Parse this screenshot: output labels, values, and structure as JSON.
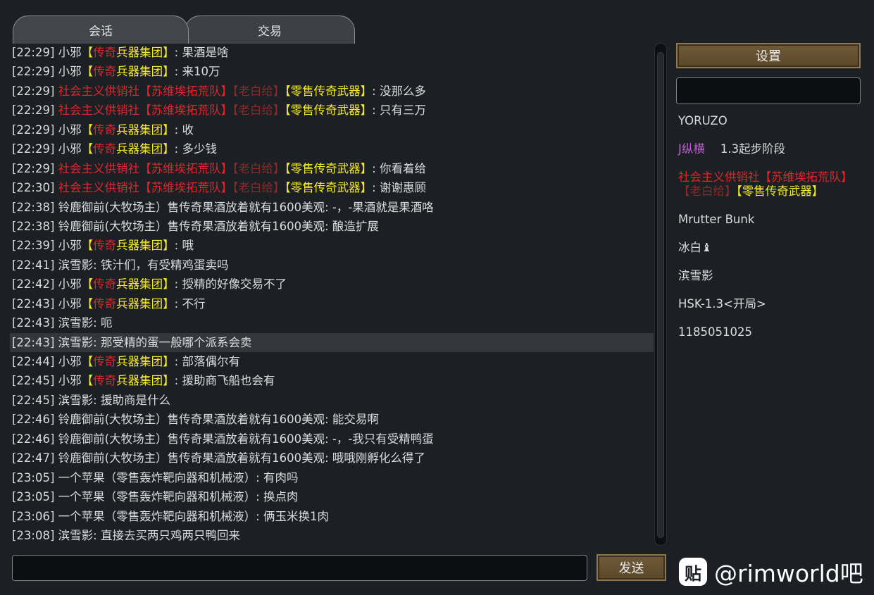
{
  "tabs": [
    {
      "label": "会话",
      "active": true
    },
    {
      "label": "交易",
      "active": false
    }
  ],
  "colors": {
    "white": "#dcdcdc",
    "red": "#e0262b",
    "yellow": "#f5ea2a",
    "darkred": "#8a2a2a",
    "purple": "#c45bd6"
  },
  "messages": [
    {
      "segments": [
        {
          "text": "[22:29] 小邪",
          "color": "#dcdcdc"
        },
        {
          "text": "【",
          "color": "#f5ea2a"
        },
        {
          "text": "传奇",
          "color": "#e0262b"
        },
        {
          "text": "兵器集团】",
          "color": "#f5ea2a"
        },
        {
          "text": ": 果酒是啥",
          "color": "#dcdcdc"
        }
      ]
    },
    {
      "segments": [
        {
          "text": "[22:29] 小邪",
          "color": "#dcdcdc"
        },
        {
          "text": "【",
          "color": "#f5ea2a"
        },
        {
          "text": "传奇",
          "color": "#e0262b"
        },
        {
          "text": "兵器集团】",
          "color": "#f5ea2a"
        },
        {
          "text": ": 来10万",
          "color": "#dcdcdc"
        }
      ]
    },
    {
      "segments": [
        {
          "text": "[22:29] ",
          "color": "#dcdcdc"
        },
        {
          "text": "社会主义供销社【苏维埃拓荒队】",
          "color": "#e0262b"
        },
        {
          "text": "【老白给】",
          "color": "#8a2a2a"
        },
        {
          "text": "【零售传奇武器】",
          "color": "#f5ea2a"
        },
        {
          "text": ": 没那么多",
          "color": "#dcdcdc"
        }
      ]
    },
    {
      "segments": [
        {
          "text": "[22:29] ",
          "color": "#dcdcdc"
        },
        {
          "text": "社会主义供销社【苏维埃拓荒队】",
          "color": "#e0262b"
        },
        {
          "text": "【老白给】",
          "color": "#8a2a2a"
        },
        {
          "text": "【零售传奇武器】",
          "color": "#f5ea2a"
        },
        {
          "text": ": 只有三万",
          "color": "#dcdcdc"
        }
      ]
    },
    {
      "segments": [
        {
          "text": "[22:29] 小邪",
          "color": "#dcdcdc"
        },
        {
          "text": "【",
          "color": "#f5ea2a"
        },
        {
          "text": "传奇",
          "color": "#e0262b"
        },
        {
          "text": "兵器集团】",
          "color": "#f5ea2a"
        },
        {
          "text": ": 收",
          "color": "#dcdcdc"
        }
      ]
    },
    {
      "segments": [
        {
          "text": "[22:29] 小邪",
          "color": "#dcdcdc"
        },
        {
          "text": "【",
          "color": "#f5ea2a"
        },
        {
          "text": "传奇",
          "color": "#e0262b"
        },
        {
          "text": "兵器集团】",
          "color": "#f5ea2a"
        },
        {
          "text": ": 多少钱",
          "color": "#dcdcdc"
        }
      ]
    },
    {
      "segments": [
        {
          "text": "[22:29] ",
          "color": "#dcdcdc"
        },
        {
          "text": "社会主义供销社【苏维埃拓荒队】",
          "color": "#e0262b"
        },
        {
          "text": "【老白给】",
          "color": "#8a2a2a"
        },
        {
          "text": "【零售传奇武器】",
          "color": "#f5ea2a"
        },
        {
          "text": ": 你看着给",
          "color": "#dcdcdc"
        }
      ]
    },
    {
      "segments": [
        {
          "text": "[22:30] ",
          "color": "#dcdcdc"
        },
        {
          "text": "社会主义供销社【苏维埃拓荒队】",
          "color": "#e0262b"
        },
        {
          "text": "【老白给】",
          "color": "#8a2a2a"
        },
        {
          "text": "【零售传奇武器】",
          "color": "#f5ea2a"
        },
        {
          "text": ": 谢谢惠顾",
          "color": "#dcdcdc"
        }
      ]
    },
    {
      "segments": [
        {
          "text": "[22:38] 铃鹿御前(大牧场主）售传奇果酒放着就有1600美观: -，-果酒就是果酒咯",
          "color": "#dcdcdc"
        }
      ]
    },
    {
      "segments": [
        {
          "text": "[22:38] 铃鹿御前(大牧场主）售传奇果酒放着就有1600美观: 酿造扩展",
          "color": "#dcdcdc"
        }
      ]
    },
    {
      "segments": [
        {
          "text": "[22:39] 小邪",
          "color": "#dcdcdc"
        },
        {
          "text": "【",
          "color": "#f5ea2a"
        },
        {
          "text": "传奇",
          "color": "#e0262b"
        },
        {
          "text": "兵器集团】",
          "color": "#f5ea2a"
        },
        {
          "text": ": 哦",
          "color": "#dcdcdc"
        }
      ]
    },
    {
      "segments": [
        {
          "text": "[22:41] 滨雪影: 铁汁们，有受精鸡蛋卖吗",
          "color": "#dcdcdc"
        }
      ]
    },
    {
      "segments": [
        {
          "text": "[22:42] 小邪",
          "color": "#dcdcdc"
        },
        {
          "text": "【",
          "color": "#f5ea2a"
        },
        {
          "text": "传奇",
          "color": "#e0262b"
        },
        {
          "text": "兵器集团】",
          "color": "#f5ea2a"
        },
        {
          "text": ": 授精的好像交易不了",
          "color": "#dcdcdc"
        }
      ]
    },
    {
      "segments": [
        {
          "text": "[22:43] 小邪",
          "color": "#dcdcdc"
        },
        {
          "text": "【",
          "color": "#f5ea2a"
        },
        {
          "text": "传奇",
          "color": "#e0262b"
        },
        {
          "text": "兵器集团】",
          "color": "#f5ea2a"
        },
        {
          "text": ": 不行",
          "color": "#dcdcdc"
        }
      ]
    },
    {
      "segments": [
        {
          "text": "[22:43] 滨雪影: 呃",
          "color": "#dcdcdc"
        }
      ]
    },
    {
      "highlight": true,
      "segments": [
        {
          "text": "[22:43] 滨雪影: 那受精的蛋一般哪个派系会卖",
          "color": "#dcdcdc"
        }
      ]
    },
    {
      "segments": [
        {
          "text": "[22:44] 小邪",
          "color": "#dcdcdc"
        },
        {
          "text": "【",
          "color": "#f5ea2a"
        },
        {
          "text": "传奇",
          "color": "#e0262b"
        },
        {
          "text": "兵器集团】",
          "color": "#f5ea2a"
        },
        {
          "text": ": 部落偶尔有",
          "color": "#dcdcdc"
        }
      ]
    },
    {
      "segments": [
        {
          "text": "[22:45] 小邪",
          "color": "#dcdcdc"
        },
        {
          "text": "【",
          "color": "#f5ea2a"
        },
        {
          "text": "传奇",
          "color": "#e0262b"
        },
        {
          "text": "兵器集团】",
          "color": "#f5ea2a"
        },
        {
          "text": ": 援助商飞船也会有",
          "color": "#dcdcdc"
        }
      ]
    },
    {
      "segments": [
        {
          "text": "[22:45] 滨雪影: 援助商是什么",
          "color": "#dcdcdc"
        }
      ]
    },
    {
      "segments": [
        {
          "text": "[22:46] 铃鹿御前(大牧场主）售传奇果酒放着就有1600美观: 能交易啊",
          "color": "#dcdcdc"
        }
      ]
    },
    {
      "segments": [
        {
          "text": "[22:46] 铃鹿御前(大牧场主）售传奇果酒放着就有1600美观: -，-我只有受精鸭蛋",
          "color": "#dcdcdc"
        }
      ]
    },
    {
      "segments": [
        {
          "text": "[22:47] 铃鹿御前(大牧场主）售传奇果酒放着就有1600美观: 哦哦刚孵化么得了",
          "color": "#dcdcdc"
        }
      ]
    },
    {
      "segments": [
        {
          "text": "[23:05] 一个苹果（零售轰炸靶向器和机械液）: 有肉吗",
          "color": "#dcdcdc"
        }
      ]
    },
    {
      "segments": [
        {
          "text": "[23:05] 一个苹果（零售轰炸靶向器和机械液）: 换点肉",
          "color": "#dcdcdc"
        }
      ]
    },
    {
      "segments": [
        {
          "text": "[23:06] 一个苹果（零售轰炸靶向器和机械液）: 俩玉米换1肉",
          "color": "#dcdcdc"
        }
      ]
    },
    {
      "segments": [
        {
          "text": "[23:08] 滨雪影: 直接去买两只鸡两只鸭回来",
          "color": "#dcdcdc"
        }
      ]
    }
  ],
  "sidebar": {
    "settings_label": "设置",
    "search_value": "",
    "players": [
      {
        "segments": [
          {
            "text": "YORUZO",
            "color": "#dcdcdc"
          }
        ]
      },
      {
        "segments": [
          {
            "text": "J纵横",
            "color": "#c45bd6"
          }
        ],
        "extra": "1.3起步阶段"
      },
      {
        "segments": [
          {
            "text": "社会主义供销社【苏维埃拓荒队】",
            "color": "#e0262b"
          },
          {
            "text": "【老白给】",
            "color": "#8a2a2a"
          },
          {
            "text": "【零售传奇武器】",
            "color": "#f5ea2a"
          }
        ]
      },
      {
        "segments": [
          {
            "text": "Mrutter Bunk",
            "color": "#dcdcdc"
          }
        ]
      },
      {
        "segments": [
          {
            "text": "冰白",
            "color": "#dcdcdc"
          },
          {
            "text": "♝",
            "color": "#dcdcdc"
          }
        ]
      },
      {
        "segments": [
          {
            "text": "滨雪影",
            "color": "#dcdcdc"
          }
        ]
      },
      {
        "segments": [
          {
            "text": "HSK-1.3<开局>",
            "color": "#dcdcdc"
          }
        ]
      },
      {
        "segments": [
          {
            "text": "1185051025",
            "color": "#dcdcdc"
          }
        ]
      }
    ]
  },
  "input": {
    "chat_value": "",
    "send_label": "发送"
  },
  "watermark": {
    "icon": "贴",
    "text": "@rimworld吧"
  }
}
